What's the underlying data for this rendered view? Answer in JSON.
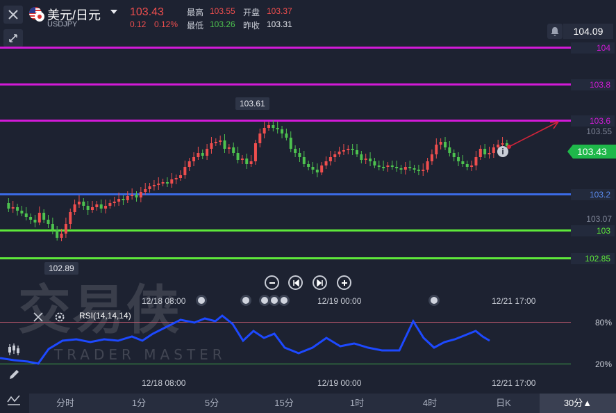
{
  "header": {
    "symbol_name": "美元/日元",
    "symbol_code": "USDJPY",
    "last_price": "103.43",
    "change": "0.12",
    "change_pct": "0.12%",
    "high_label": "最高",
    "high_value": "103.55",
    "open_label": "开盘",
    "open_value": "103.37",
    "low_label": "最低",
    "low_value": "103.26",
    "prev_close_label": "昨收",
    "prev_close_value": "103.31"
  },
  "alert_price": "104.09",
  "price_axis": {
    "levels": [
      {
        "value": "104",
        "color": "#d21ad7"
      },
      {
        "value": "103.8",
        "color": "#d21ad7"
      },
      {
        "value": "103.6",
        "color": "#d21ad7"
      },
      {
        "value": "103.2",
        "color": "#3b6be6"
      },
      {
        "value": "103",
        "color": "#5ee83a"
      },
      {
        "value": "102.85",
        "color": "#5ee83a"
      }
    ],
    "plain_ticks": [
      "103.55",
      "103.07"
    ],
    "current_price": "103.43"
  },
  "tooltips": {
    "high_marker": "103.61",
    "low_marker": "102.89"
  },
  "time_axis": [
    "12/18 08:00",
    "12/19 00:00",
    "12/21 17:00"
  ],
  "rsi": {
    "label": "RSI(14,14,14)",
    "upper": "80%",
    "lower": "20%"
  },
  "timeframes": [
    "分时",
    "1分",
    "5分",
    "15分",
    "1时",
    "4时",
    "日K",
    "30分▲"
  ],
  "active_timeframe": "30分▲",
  "watermark": {
    "title": "交易侠",
    "subtitle": "TRADER MASTER"
  },
  "colors": {
    "up": "#ef4e4e",
    "down": "#4dc24f",
    "rsi_line": "#1d49ff",
    "background": "#1d2231"
  },
  "icons": [
    "close-icon",
    "us-flag-icon",
    "caret-down-icon",
    "collapse-arrows-icon",
    "bell-icon",
    "zoom-out-icon",
    "step-back-icon",
    "step-forward-icon",
    "zoom-in-icon",
    "info-icon",
    "close-icon",
    "gear-icon",
    "candles-icon",
    "pencil-icon",
    "indicator-icon"
  ]
}
